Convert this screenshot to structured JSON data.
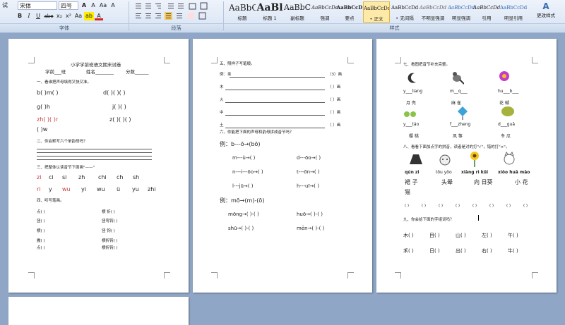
{
  "ribbon": {
    "left_label": "试",
    "font_name": "宋体",
    "font_size": "四号",
    "font_grow": "A",
    "font_shrink": "A",
    "aa_label": "Aa",
    "clear_label": "A",
    "bold": "B",
    "italic": "I",
    "underline": "U",
    "strike": "abe",
    "sub": "x₂",
    "sup": "x²",
    "aa2": "Aa",
    "highlight": "ab",
    "fontcolor": "A",
    "group_font": "字体",
    "group_paragraph": "段落",
    "group_style": "样式",
    "styles": [
      {
        "sample": "AaBbC",
        "label": "标题"
      },
      {
        "sample": "AaBl",
        "label": "标题 1"
      },
      {
        "sample": "AaBbC",
        "label": "副标题"
      },
      {
        "sample": "AaBbCcDe",
        "label": "强调"
      },
      {
        "sample": "AaBbCcD",
        "label": "要点"
      },
      {
        "sample": "AaBbCcDd",
        "label": "• 正文"
      },
      {
        "sample": "AaBbCcDd",
        "label": "• 无间隔"
      },
      {
        "sample": "AaBbCcDd",
        "label": "不明显强调"
      },
      {
        "sample": "AaBbCcDd",
        "label": "明显强调"
      },
      {
        "sample": "AaBbCcDd",
        "label": "引用"
      },
      {
        "sample": "AaBbCcDd",
        "label": "明显引用"
      }
    ],
    "change_styles": "更改样式"
  },
  "page1": {
    "title": "小学学前班语文期末试卷",
    "info": [
      "学前___班",
      "姓名________",
      "分数______"
    ],
    "q1": "一、看谁把声母填得又快又准。",
    "r1": [
      "b(   )m(   )",
      "d(   )(   )(   )"
    ],
    "r2": [
      "g(   )h",
      "j(   )(   )"
    ],
    "r3": [
      "zh(   )(   )r",
      "z(   )(   )(   )"
    ],
    "r4": "(   )w",
    "q2": "二、你会默写六个单韵母吗？",
    "q3": "三、把整体认读音节下面画\"——\"",
    "syl1": [
      "zi",
      "ci",
      "si",
      "zh",
      "chi",
      "ch",
      "sh"
    ],
    "syl2": [
      "ri",
      "y",
      "wu",
      "yi",
      "wu",
      "ü",
      "yu",
      "zhi"
    ],
    "q4": "四、听写笔画。",
    "strokes": [
      [
        "点(          )",
        "横  折(          )"
      ],
      [
        "竖(          )",
        "竖弯钩(          )"
      ],
      [
        "横(          )",
        "竖  钩(          )"
      ],
      [
        "撇(          )",
        "横折钩(          )"
      ],
      [
        "点(          )",
        "横折钩(          )"
      ]
    ]
  },
  "page2": {
    "q5": "五、照样子写笔顺。",
    "lines": [
      [
        "例：亲",
        "（3）画"
      ],
      [
        "木",
        "（   ）画"
      ],
      [
        "火",
        "（   ）画"
      ],
      [
        "中",
        "（   ）画"
      ],
      [
        "土",
        "（   ）画"
      ]
    ],
    "q6": "六、你能把下面的声母和韵母拼成音节吗？",
    "ex1": "例：b---ō→(bō)",
    "pairs": [
      [
        "m---ù→(    )",
        "d---ōo→(    )"
      ],
      [
        "n---i---ōo→(    )",
        "t---ōn→(    )"
      ],
      [
        "l---jū→(    )",
        "h---uī→(    )"
      ]
    ],
    "ex2": "例：mō→(m)-(ō)",
    "split": [
      [
        "mōng→(   )-(   )",
        "huō→(   )-(   )"
      ],
      [
        "shū→(   )-(   )",
        "mēn→(   )-(   )"
      ]
    ]
  },
  "page3": {
    "q7": "七、看图把音节补充完整。",
    "fill": [
      [
        "y___liang",
        "m__q___",
        "hu___b___"
      ],
      [
        "月  亮",
        "麻  雀",
        "花  蝴"
      ],
      [
        "y___táo",
        "f___zheng",
        "d___guā"
      ],
      [
        "樱  桃",
        "风  筝",
        "冬  瓜"
      ]
    ],
    "q8": "八、看看下面加点字的拼音，读者是对的打\"√\"，错的打\"×\"。",
    "pinyin": [
      "qún zi",
      "tōu yōo",
      "xiàng rì kǔi",
      "xiǒo huā māo"
    ],
    "words": [
      "裙  子",
      "头晕",
      "向  日葵",
      "小  花"
    ],
    "word_extra": "猫",
    "checks": [
      "(   )",
      "(   )",
      "(   )",
      "(   )",
      "(   )",
      "(   )",
      "(   )",
      "(   )"
    ],
    "q9": "九、你会给下面的字组词吗？",
    "g1": [
      "木(    )",
      "目(    )",
      "山(    )",
      "左(    )",
      "午(    )"
    ],
    "g2": [
      "禾(    )",
      "日(    )",
      "出(    )",
      "右(    )",
      "牛(    )"
    ]
  },
  "colors": {
    "background": "#8fa6c6",
    "ribbon": "#dbe6f4",
    "accent_red": "#c43b3b"
  }
}
